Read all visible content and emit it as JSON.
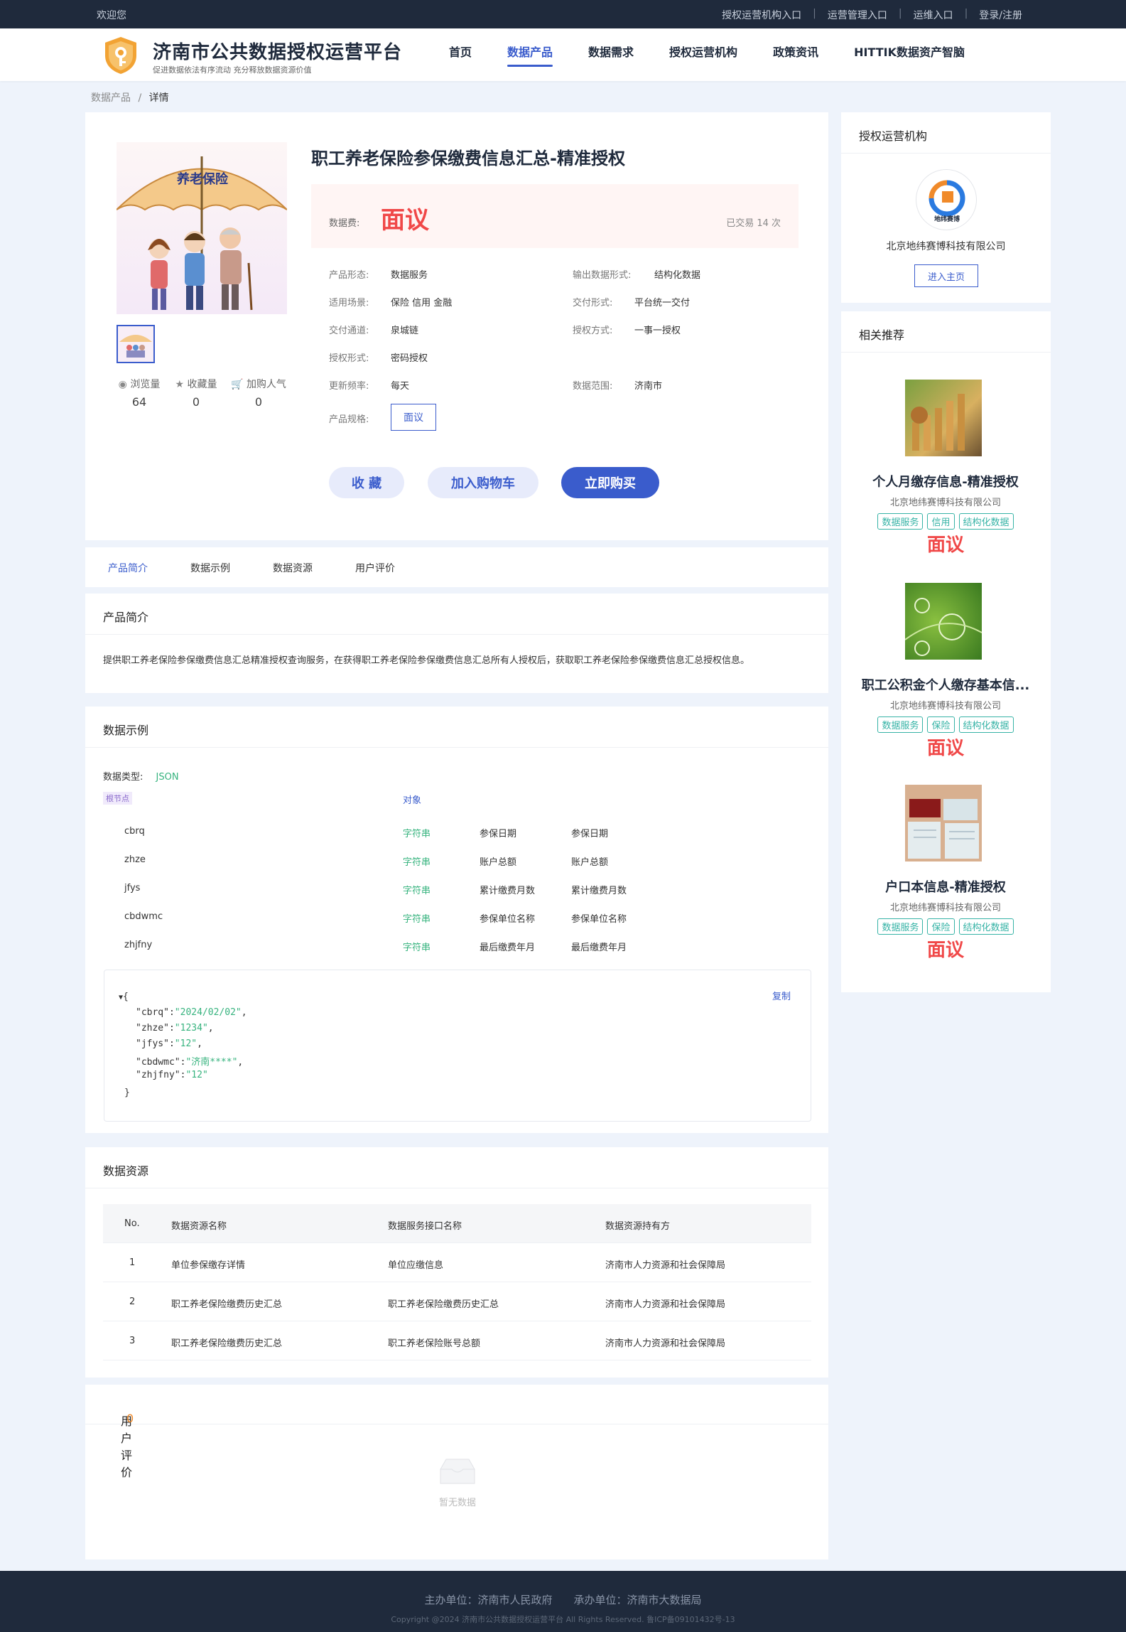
{
  "topbar": {
    "welcome": "欢迎您",
    "links": [
      "授权运营机构入口",
      "运营管理入口",
      "运维入口",
      "登录/注册"
    ]
  },
  "header": {
    "title": "济南市公共数据授权运营平台",
    "subtitle": "促进数据依法有序流动 充分释放数据资源价值",
    "nav": [
      "首页",
      "数据产品",
      "数据需求",
      "授权运营机构",
      "政策资讯",
      "HITTIK数据资产智脑"
    ],
    "nav_active": "数据产品"
  },
  "breadcrumb": {
    "parent": "数据产品",
    "sep": "/",
    "current": "详情"
  },
  "product": {
    "image_text": "养老保险",
    "title": "职工养老保险参保缴费信息汇总-精准授权",
    "price_label": "数据费:",
    "price": "面议",
    "sold": "已交易 14 次",
    "stats": [
      {
        "label": "浏览量",
        "icon": "eye-icon",
        "value": "64"
      },
      {
        "label": "收藏量",
        "icon": "star-icon",
        "value": "0"
      },
      {
        "label": "加购人气",
        "icon": "cart-icon",
        "value": "0"
      }
    ],
    "attrs": {
      "form_label": "产品形态:",
      "form": "数据服务",
      "output_label": "输出数据形式:",
      "output": "结构化数据",
      "scene_label": "适用场景:",
      "scene": "保险  信用  金融",
      "delivery_label": "交付形式:",
      "delivery": "平台统一交付",
      "channel_label": "交付通道:",
      "channel": "泉城链",
      "auth_method_label": "授权方式:",
      "auth_method": "一事一授权",
      "auth_form_label": "授权形式:",
      "auth_form": "密码授权",
      "freq_label": "更新频率:",
      "freq": "每天",
      "range_label": "数据范围:",
      "range": "济南市",
      "spec_label": "产品规格:",
      "spec": "面议"
    },
    "buttons": {
      "favorite": "收 藏",
      "cart": "加入购物车",
      "buy": "立即购买"
    }
  },
  "tabs": [
    "产品简介",
    "数据示例",
    "数据资源",
    "用户评价"
  ],
  "intro": {
    "heading": "产品简介",
    "text": "提供职工养老保险参保缴费信息汇总精准授权查询服务，在获得职工养老保险参保缴费信息汇总所有人授权后，获取职工养老保险参保缴费信息汇总授权信息。"
  },
  "example": {
    "heading": "数据示例",
    "type_label": "数据类型:",
    "type": "JSON",
    "root_tag": "根节点",
    "root_type": "对象",
    "fields": [
      {
        "name": "cbrq",
        "type": "字符串",
        "desc": "参保日期",
        "desc2": "参保日期"
      },
      {
        "name": "zhze",
        "type": "字符串",
        "desc": "账户总额",
        "desc2": "账户总额"
      },
      {
        "name": "jfys",
        "type": "字符串",
        "desc": "累计缴费月数",
        "desc2": "累计缴费月数"
      },
      {
        "name": "cbdwmc",
        "type": "字符串",
        "desc": "参保单位名称",
        "desc2": "参保单位名称"
      },
      {
        "name": "zhjfny",
        "type": "字符串",
        "desc": "最后缴费年月",
        "desc2": "最后缴费年月"
      }
    ],
    "copy": "复制",
    "json": [
      {
        "key": "cbrq",
        "val": "2024/02/02"
      },
      {
        "key": "zhze",
        "val": "1234"
      },
      {
        "key": "jfys",
        "val": "12"
      },
      {
        "key": "cbdwmc",
        "val": "济南****"
      },
      {
        "key": "zhjfny",
        "val": "12"
      }
    ]
  },
  "resources": {
    "heading": "数据资源",
    "columns": [
      "No.",
      "数据资源名称",
      "数据服务接口名称",
      "数据资源持有方"
    ],
    "rows": [
      [
        "1",
        "单位参保缴存详情",
        "单位应缴信息",
        "济南市人力资源和社会保障局"
      ],
      [
        "2",
        "职工养老保险缴费历史汇总",
        "职工养老保险缴费历史汇总",
        "济南市人力资源和社会保障局"
      ],
      [
        "3",
        "职工养老保险缴费历史汇总",
        "职工养老保险账号总额",
        "济南市人力资源和社会保障局"
      ]
    ]
  },
  "reviews": {
    "heading": "用户评价",
    "count": "0",
    "empty": "暂无数据"
  },
  "org": {
    "heading": "授权运营机构",
    "logo_text": "地纬赛博",
    "name": "北京地纬赛博科技有限公司",
    "button": "进入主页"
  },
  "recommend": {
    "heading": "相关推荐",
    "items": [
      {
        "title": "个人月缴存信息-精准授权",
        "org": "北京地纬赛博科技有限公司",
        "tags": [
          "数据服务",
          "信用",
          "结构化数据"
        ],
        "price": "面议"
      },
      {
        "title": "职工公积金个人缴存基本信...",
        "org": "北京地纬赛博科技有限公司",
        "tags": [
          "数据服务",
          "保险",
          "结构化数据"
        ],
        "price": "面议"
      },
      {
        "title": "户口本信息-精准授权",
        "org": "北京地纬赛博科技有限公司",
        "tags": [
          "数据服务",
          "保险",
          "结构化数据"
        ],
        "price": "面议"
      }
    ]
  },
  "footer": {
    "line1": "主办单位：济南市人民政府　　承办单位：济南市大数据局",
    "line2": "Copyright @2024 济南市公共数据授权运营平台 All Rights Reserved. 鲁ICP备09101432号-13"
  },
  "colors": {
    "accent": "#3a5ccc",
    "price": "#f04848",
    "tag": "#36b3a6",
    "dark": "#1f2a3c"
  }
}
